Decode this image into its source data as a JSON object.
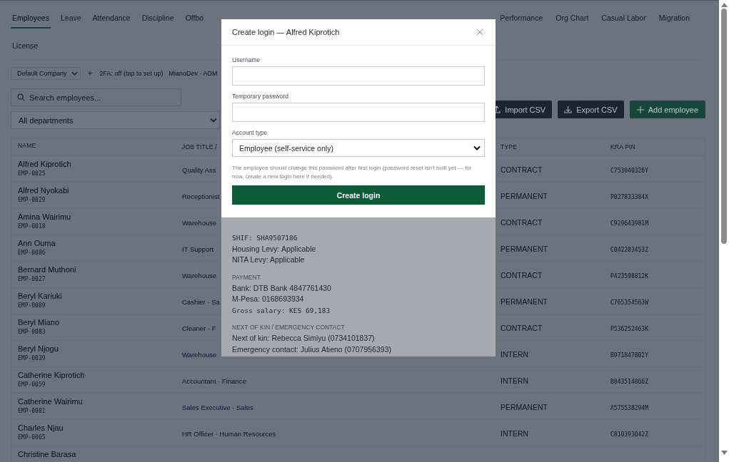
{
  "tabs_left": [
    {
      "label": "Employees",
      "selected": true
    },
    {
      "label": "Leave",
      "selected": false
    },
    {
      "label": "Attendance",
      "selected": false
    },
    {
      "label": "Discipline",
      "selected": false
    },
    {
      "label": "Offbo",
      "selected": false
    }
  ],
  "tabs_right": [
    {
      "label": "Performance",
      "selected": false
    },
    {
      "label": "Org Chart",
      "selected": false
    },
    {
      "label": "Casual Labor",
      "selected": false
    },
    {
      "label": "Migration",
      "selected": false
    }
  ],
  "tabs_second_row": [
    {
      "label": "License",
      "selected": false
    }
  ],
  "company_select": {
    "value": "Default Company"
  },
  "add_company": "+",
  "two_factor": "2FA: off (tap to set up)",
  "user": "MianoDev · ADM",
  "search": {
    "placeholder": "Search employees..."
  },
  "department_select": {
    "value": "All departments"
  },
  "actions": [
    {
      "label": "Import CSV",
      "kind": "upload"
    },
    {
      "label": "Export CSV",
      "kind": "download"
    },
    {
      "label": "Add employee",
      "kind": "add"
    }
  ],
  "table": {
    "columns": [
      "NAME",
      "JOB TITLE /",
      "TYPE",
      "KRA PIN"
    ],
    "rows": [
      {
        "name": "Alfred Kiprotich",
        "id": "EMP-0025",
        "job": "Quality Ass",
        "type": "CONTRACT",
        "kra": "C753040326Y"
      },
      {
        "name": "Alfred Nyokabi",
        "id": "EMP-0029",
        "job": "Receptionist",
        "type": "PERMANENT",
        "kra": "P027833384X"
      },
      {
        "name": "Amina Wairimu",
        "id": "EMP-0018",
        "job": "Warehouse",
        "type": "CONTRACT",
        "kra": "C929643981M"
      },
      {
        "name": "Ann Ouma",
        "id": "EMP-0086",
        "job": "IT Support",
        "type": "PERMANENT",
        "kra": "C042203453Z"
      },
      {
        "name": "Bernard Muthoni",
        "id": "EMP-0027",
        "job": "Warehouse",
        "type": "CONTRACT",
        "kra": "P423598812K"
      },
      {
        "name": "Beryl Kariuki",
        "id": "EMP-0089",
        "job": "Cashier · Sa",
        "type": "PERMANENT",
        "kra": "C765354563W"
      },
      {
        "name": "Beryl Miano",
        "id": "EMP-0083",
        "job": "Cleaner · F",
        "type": "CONTRACT",
        "kra": "P536252463K"
      },
      {
        "name": "Beryl Njogu",
        "id": "EMP-0039",
        "job": "Warehouse",
        "type": "INTERN",
        "kra": "B971847802Y"
      },
      {
        "name": "Catherine Kiprotich",
        "id": "EMP-0059",
        "job": "Accountant · Finance",
        "type": "INTERN",
        "kra": "B843514866Z"
      },
      {
        "name": "Catherine Wairimu",
        "id": "EMP-0081",
        "job": "Sales Executive · Sales",
        "type": "PERMANENT",
        "kra": "A575538294M"
      },
      {
        "name": "Charles Njau",
        "id": "EMP-0065",
        "job": "HR Officer · Human Resources",
        "type": "INTERN",
        "kra": "C810393042Z"
      },
      {
        "name": "Christine Barasa"
      }
    ]
  },
  "detail_panel": {
    "sections": [
      {
        "lines": [
          {
            "text": "SHIF: SHA9507186",
            "kind": "mono"
          },
          {
            "text": "Housing Levy: Applicable",
            "kind": "plain"
          },
          {
            "text": "NITA Levy: Applicable",
            "kind": "plain"
          }
        ]
      },
      {
        "heading": "PAYMENT",
        "lines": [
          {
            "text": "Bank: DTB Bank 4847761430",
            "kind": "plain"
          },
          {
            "text": "M-Pesa: 0168693934",
            "kind": "plain"
          },
          {
            "text": "Gross salary: KES 69,183",
            "kind": "mono"
          }
        ]
      },
      {
        "heading": "NEXT OF KIN / EMERGENCY CONTACT",
        "lines": [
          {
            "text": "Next of kin: Rebecca Simiyu (0734101837)",
            "kind": "plain"
          },
          {
            "text": "Emergency contact: Julius Atieno (0707956393)",
            "kind": "plain"
          }
        ]
      }
    ]
  },
  "login_dialog": {
    "title": "Create login — Alfred Kiprotich",
    "fields": [
      {
        "label": "Username",
        "kind": "text"
      },
      {
        "label": "Temporary password",
        "kind": "text"
      },
      {
        "label": "Account type",
        "kind": "select",
        "value": "Employee (self-service only)"
      }
    ],
    "hint": "The employee should change this password after first login (password reset isn't built yet — for now, create a new login here if needed).",
    "submit": "Create login"
  }
}
